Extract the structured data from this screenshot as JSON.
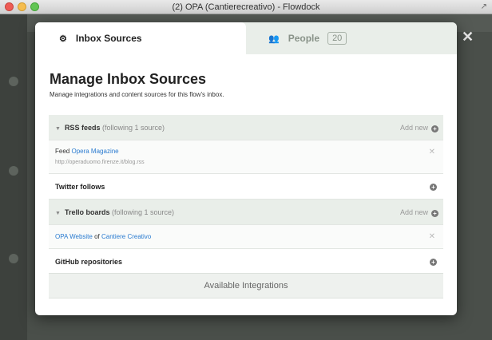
{
  "window": {
    "title": "(2) OPA (Cantierecreativo) - Flowdock"
  },
  "tabs": [
    {
      "label": "Inbox Sources",
      "icon": "gear-icon"
    },
    {
      "label": "People",
      "icon": "people-icon",
      "count": "20"
    }
  ],
  "header": {
    "title": "Manage Inbox Sources",
    "subtitle": "Manage integrations and content sources for this flow's inbox."
  },
  "sections": {
    "rss": {
      "title": "RSS feeds",
      "meta": "(following 1 source)",
      "add_label": "Add new",
      "item": {
        "prefix": "Feed",
        "name": "Opera Magazine",
        "url": "http://operaduomo.firenze.it/blog.rss"
      }
    },
    "twitter": {
      "title": "Twitter follows"
    },
    "trello": {
      "title": "Trello boards",
      "meta": "(following 1 source)",
      "add_label": "Add new",
      "item": {
        "board": "OPA Website",
        "of": "of",
        "org": "Cantiere Creativo"
      }
    },
    "github": {
      "title": "GitHub repositories"
    }
  },
  "footer": {
    "integrations_label": "Available Integrations"
  },
  "colors": {
    "link": "#2a7bd0",
    "section_bg": "#e9eee9"
  }
}
